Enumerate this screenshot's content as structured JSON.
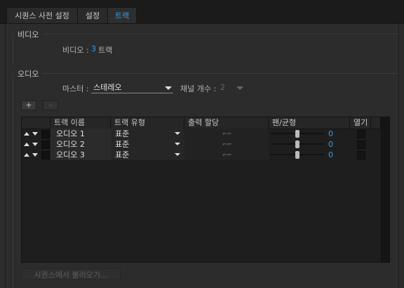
{
  "tabs": [
    {
      "label": "시퀀스 사전 설정"
    },
    {
      "label": "설정"
    },
    {
      "label": "트랙"
    }
  ],
  "video": {
    "group_label": "비디오",
    "field_label": "비디오 :",
    "track_count": "3",
    "track_unit": "트랙"
  },
  "audio": {
    "group_label": "오디오",
    "master_label": "마스터 :",
    "master_value": "스테레오",
    "channels_label": "채널 개수 :",
    "channels_value": "2",
    "add_button": "+",
    "remove_button": "-"
  },
  "table": {
    "headers": [
      "트랙 이름",
      "트랙 유형",
      "출력 할당",
      "팬/균형",
      "열기"
    ],
    "rows": [
      {
        "name": "오디오 1",
        "type": "표준",
        "pan": "0"
      },
      {
        "name": "오디오 2",
        "type": "표준",
        "pan": "0"
      },
      {
        "name": "오디오 3",
        "type": "표준",
        "pan": "0"
      }
    ]
  },
  "footer": {
    "load_from_sequence": "시퀀스에서 불러오기..."
  },
  "colors": {
    "accent": "#3e9cdd",
    "background": "#2c2c2c",
    "table_bg": "#1e1e1e"
  }
}
